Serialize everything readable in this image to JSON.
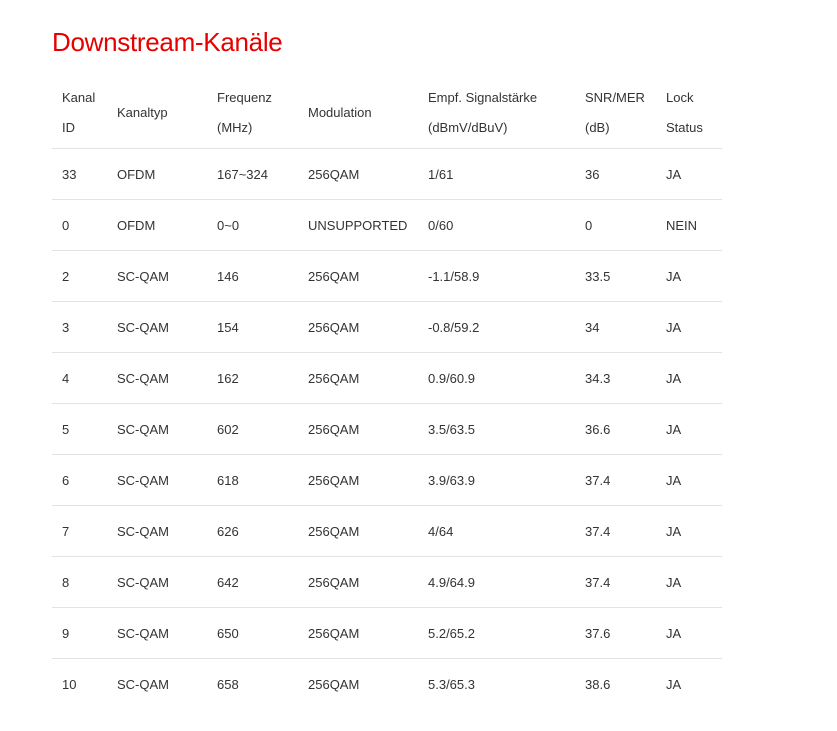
{
  "page": {
    "title": "Downstream-Kanäle"
  },
  "colors": {
    "title": "#e60000",
    "text": "#333333",
    "row_border": "#e3e3e3"
  },
  "table": {
    "headers": [
      {
        "line1": "Kanal",
        "line2": "ID"
      },
      {
        "line1": "Kanaltyp",
        "line2": ""
      },
      {
        "line1": "Frequenz",
        "line2": "(MHz)"
      },
      {
        "line1": "Modulation",
        "line2": ""
      },
      {
        "line1": "Empf. Signalstärke",
        "line2": "(dBmV/dBuV)"
      },
      {
        "line1": "SNR/MER",
        "line2": "(dB)"
      },
      {
        "line1": "Lock",
        "line2": "Status"
      }
    ],
    "rows": [
      [
        "33",
        "OFDM",
        "167~324",
        "256QAM",
        "1/61",
        "36",
        "JA"
      ],
      [
        "0",
        "OFDM",
        "0~0",
        "UNSUPPORTED",
        "0/60",
        "0",
        "NEIN"
      ],
      [
        "2",
        "SC-QAM",
        "146",
        "256QAM",
        "-1.1/58.9",
        "33.5",
        "JA"
      ],
      [
        "3",
        "SC-QAM",
        "154",
        "256QAM",
        "-0.8/59.2",
        "34",
        "JA"
      ],
      [
        "4",
        "SC-QAM",
        "162",
        "256QAM",
        "0.9/60.9",
        "34.3",
        "JA"
      ],
      [
        "5",
        "SC-QAM",
        "602",
        "256QAM",
        "3.5/63.5",
        "36.6",
        "JA"
      ],
      [
        "6",
        "SC-QAM",
        "618",
        "256QAM",
        "3.9/63.9",
        "37.4",
        "JA"
      ],
      [
        "7",
        "SC-QAM",
        "626",
        "256QAM",
        "4/64",
        "37.4",
        "JA"
      ],
      [
        "8",
        "SC-QAM",
        "642",
        "256QAM",
        "4.9/64.9",
        "37.4",
        "JA"
      ],
      [
        "9",
        "SC-QAM",
        "650",
        "256QAM",
        "5.2/65.2",
        "37.6",
        "JA"
      ],
      [
        "10",
        "SC-QAM",
        "658",
        "256QAM",
        "5.3/65.3",
        "38.6",
        "JA"
      ]
    ]
  }
}
